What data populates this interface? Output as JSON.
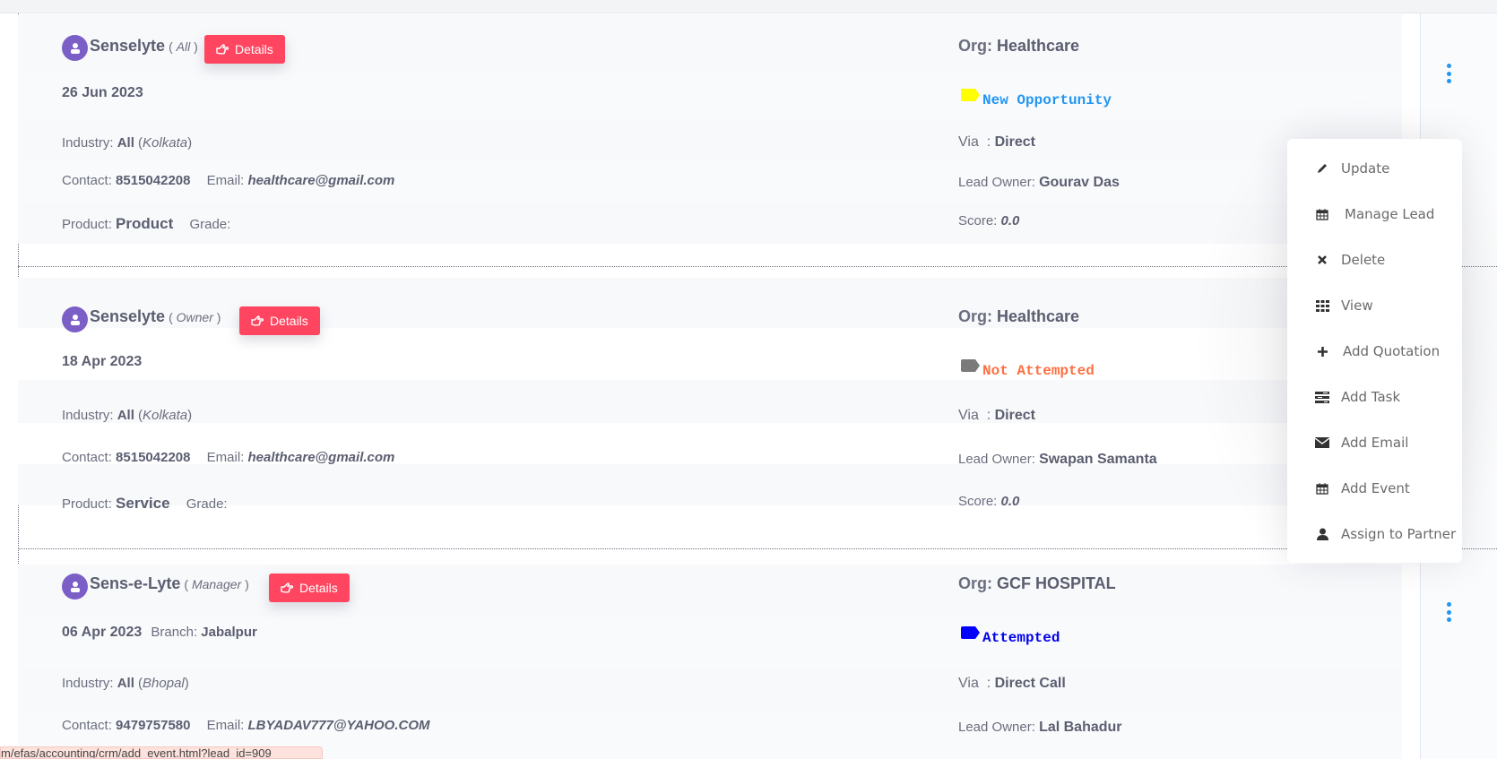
{
  "leads": [
    {
      "name": "Senselyte",
      "role": "All",
      "details_label": "Details",
      "date": "26 Jun 2023",
      "branch_label": "",
      "branch": "",
      "industry_label": "Industry:",
      "industry": "All",
      "city": "Kolkata",
      "contact_label": "Contact:",
      "contact": "8515042208",
      "email_label": "Email:",
      "email": "healthcare@gmail.com",
      "product_label": "Product:",
      "product": "Product",
      "grade_label": "Grade:",
      "grade": "",
      "org_label": "Org:",
      "org": "Healthcare",
      "status": "New Opportunity",
      "status_text_color": "#2196f3",
      "status_tag_color": "#ffff00",
      "via_label": "Via  :",
      "via": "Direct",
      "owner_label": "Lead Owner:",
      "owner": "Gourav Das",
      "score_label": "Score:",
      "score": "0.0"
    },
    {
      "name": "Senselyte",
      "role": "Owner",
      "details_label": "Details",
      "date": "18 Apr 2023",
      "branch_label": "",
      "branch": "",
      "industry_label": "Industry:",
      "industry": "All",
      "city": "Kolkata",
      "contact_label": "Contact:",
      "contact": "8515042208",
      "email_label": "Email:",
      "email": "healthcare@gmail.com",
      "product_label": "Product:",
      "product": "Service",
      "grade_label": "Grade:",
      "grade": "",
      "org_label": "Org:",
      "org": "Healthcare",
      "status": "Not Attempted",
      "status_text_color": "#ff7043",
      "status_tag_color": "#7a7a7a",
      "via_label": "Via  :",
      "via": "Direct",
      "owner_label": "Lead Owner:",
      "owner": "Swapan Samanta",
      "score_label": "Score:",
      "score": "0.0"
    },
    {
      "name": "Sens-e-Lyte",
      "role": "Manager",
      "details_label": "Details",
      "date": "06 Apr 2023",
      "branch_label": "Branch:",
      "branch": "Jabalpur",
      "industry_label": "Industry:",
      "industry": "All",
      "city": "Bhopal",
      "contact_label": "Contact:",
      "contact": "9479757580",
      "email_label": "Email:",
      "email": "LBYADAV777@YAHOO.COM",
      "org_label": "Org:",
      "org": "GCF HOSPITAL",
      "status": "Attempted",
      "status_text_color": "#0000ee",
      "status_tag_color": "#0000ff",
      "via_label": "Via  :",
      "via": "Direct Call",
      "owner_label": "Lead Owner:",
      "owner": "Lal Bahadur"
    }
  ],
  "action_menu": {
    "items": [
      {
        "label": "Update",
        "icon": "pencil-icon"
      },
      {
        "label": "Manage Lead",
        "icon": "calendar-icon"
      },
      {
        "label": "Delete",
        "icon": "close-icon"
      },
      {
        "label": "View",
        "icon": "grid-icon"
      },
      {
        "label": "Add Quotation",
        "icon": "plus-icon"
      },
      {
        "label": "Add Task",
        "icon": "tasks-icon"
      },
      {
        "label": "Add Email",
        "icon": "envelope-icon"
      },
      {
        "label": "Add Event",
        "icon": "calendar-icon"
      },
      {
        "label": "Assign to Partner",
        "icon": "user-icon"
      }
    ]
  },
  "status_bar": {
    "url": "m/efas/accounting/crm/add_event.html?lead_id=909"
  },
  "colors": {
    "accent_blue": "#2196f3",
    "details_button": "#ff4560",
    "avatar": "#7b5fc7"
  }
}
